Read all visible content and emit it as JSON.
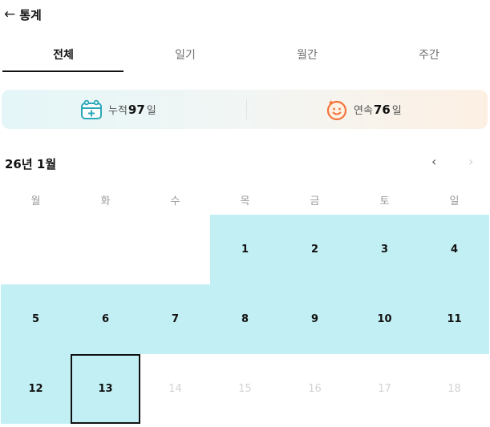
{
  "header": {
    "back_icon": "←",
    "title": "통계"
  },
  "tabs": [
    {
      "label": "전체",
      "active": true
    },
    {
      "label": "일기",
      "active": false
    },
    {
      "label": "월간",
      "active": false
    },
    {
      "label": "주간",
      "active": false
    }
  ],
  "stats": {
    "total": {
      "icon": "calendar-add-icon",
      "label": "누적",
      "value": "97",
      "unit": "일"
    },
    "streak": {
      "icon": "smiling-face-icon",
      "label": "연속",
      "value": "76",
      "unit": "일"
    }
  },
  "calendar": {
    "month_label": "26년 1월",
    "prev_icon": "‹",
    "next_icon": "›",
    "weekdays": [
      "월",
      "화",
      "수",
      "목",
      "금",
      "토",
      "일"
    ],
    "weeks": [
      [
        null,
        null,
        null,
        "1",
        "2",
        "3",
        "4"
      ],
      [
        "5",
        "6",
        "7",
        "8",
        "9",
        "10",
        "11"
      ],
      [
        "12",
        "13",
        "14",
        "15",
        "16",
        "17",
        "18"
      ]
    ],
    "filled_days": [
      "1",
      "2",
      "3",
      "4",
      "5",
      "6",
      "7",
      "8",
      "9",
      "10",
      "11",
      "12",
      "13"
    ],
    "today": "13",
    "future_days": [
      "14",
      "15",
      "16",
      "17",
      "18"
    ]
  },
  "colors": {
    "filled": "#c2eff3",
    "accent": "#111111",
    "streak_icon": "#f4743b",
    "total_icon": "#2aa8b8"
  }
}
